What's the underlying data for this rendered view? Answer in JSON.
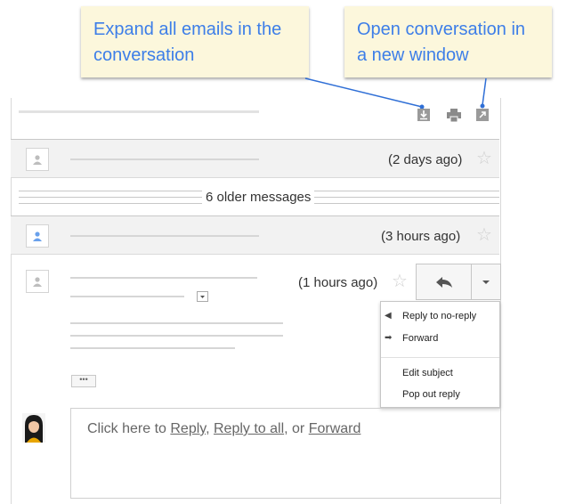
{
  "callouts": {
    "expand": "Expand all emails in the conversation",
    "open": "Open conversation in a new window"
  },
  "toolbar_icons": [
    "expand-all-icon",
    "print-icon",
    "new-window-icon"
  ],
  "messages": [
    {
      "time": "(2 days ago)",
      "avatar": "person-icon-grey"
    },
    {
      "time": "(3 hours ago)",
      "avatar": "person-icon-blue"
    },
    {
      "time": "(1 hours ago)",
      "avatar": "person-icon-grey"
    }
  ],
  "older_messages_label": "6 older messages",
  "reply_menu": {
    "items": [
      {
        "icon": "reply-icon",
        "label": "Reply to no-reply"
      },
      {
        "icon": "forward-icon",
        "label": "Forward"
      },
      {
        "icon": "",
        "label": "Edit subject"
      },
      {
        "icon": "",
        "label": "Pop out reply"
      }
    ]
  },
  "reply_box": {
    "prefix": "Click here to ",
    "reply": "Reply",
    "sep1": ", ",
    "reply_all": "Reply to all",
    "sep2": ", or ",
    "forward": "Forward"
  },
  "colors": {
    "callout_bg": "#fcf7dc",
    "callout_text": "#3d7ee8",
    "arrow": "#2f6fd6",
    "row_bg": "#f2f2f2"
  }
}
